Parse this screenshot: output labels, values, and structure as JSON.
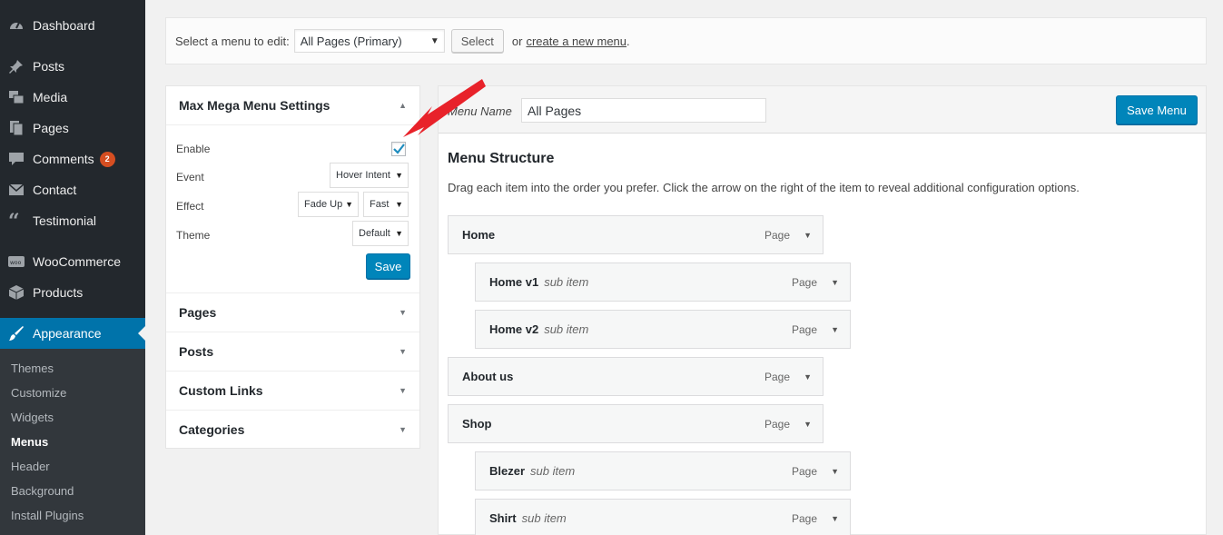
{
  "sidebar": {
    "items": [
      {
        "label": "Dashboard",
        "icon": "dashboard-icon"
      },
      {
        "label": "Posts",
        "icon": "pin-icon"
      },
      {
        "label": "Media",
        "icon": "media-icon"
      },
      {
        "label": "Pages",
        "icon": "pages-icon"
      },
      {
        "label": "Comments",
        "icon": "comment-icon",
        "badge": "2"
      },
      {
        "label": "Contact",
        "icon": "mail-icon"
      },
      {
        "label": "Testimonial",
        "icon": "quote-icon"
      },
      {
        "label": "WooCommerce",
        "icon": "woo-icon"
      },
      {
        "label": "Products",
        "icon": "box-icon"
      },
      {
        "label": "Appearance",
        "icon": "brush-icon"
      }
    ],
    "submenu": [
      "Themes",
      "Customize",
      "Widgets",
      "Menus",
      "Header",
      "Background",
      "Install Plugins"
    ],
    "current_sub": "Menus"
  },
  "topbar": {
    "label": "Select a menu to edit:",
    "selected_menu": "All Pages (Primary)",
    "select_button": "Select",
    "or_text": "or",
    "create_link": "create a new menu",
    "period": "."
  },
  "mega": {
    "title": "Max Mega Menu Settings",
    "enable_label": "Enable",
    "enabled": true,
    "event_label": "Event",
    "event_value": "Hover Intent",
    "effect_label": "Effect",
    "effect_value": "Fade Up",
    "speed_value": "Fast",
    "theme_label": "Theme",
    "theme_value": "Default",
    "save_label": "Save"
  },
  "accordions": [
    "Pages",
    "Posts",
    "Custom Links",
    "Categories"
  ],
  "menu": {
    "name_label": "Menu Name",
    "name_value": "All Pages",
    "save_button": "Save Menu",
    "structure_title": "Menu Structure",
    "structure_desc": "Drag each item into the order you prefer. Click the arrow on the right of the item to reveal additional configuration options.",
    "items": [
      {
        "title": "Home",
        "sub": "",
        "type": "Page",
        "depth": 0
      },
      {
        "title": "Home v1",
        "sub": "sub item",
        "type": "Page",
        "depth": 1
      },
      {
        "title": "Home v2",
        "sub": "sub item",
        "type": "Page",
        "depth": 1
      },
      {
        "title": "About us",
        "sub": "",
        "type": "Page",
        "depth": 0
      },
      {
        "title": "Shop",
        "sub": "",
        "type": "Page",
        "depth": 0
      },
      {
        "title": "Blezer",
        "sub": "sub item",
        "type": "Page",
        "depth": 1
      },
      {
        "title": "Shirt",
        "sub": "sub item",
        "type": "Page",
        "depth": 1
      }
    ]
  },
  "colors": {
    "accent": "#0073aa",
    "sidebar": "#23282d",
    "annotation": "#e8222a"
  }
}
